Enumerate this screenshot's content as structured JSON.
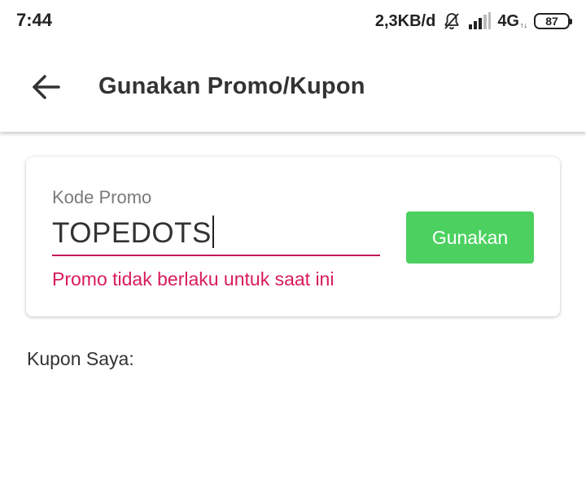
{
  "status_bar": {
    "time": "7:44",
    "network_speed": "2,3KB/d",
    "network_type": "4G",
    "network_sub": "↑↓",
    "battery": "87",
    "icons": [
      "bell-muted-icon",
      "signal-icon"
    ]
  },
  "toolbar": {
    "back_icon": "arrow-left-icon",
    "title": "Gunakan Promo/Kupon"
  },
  "promo": {
    "label": "Kode Promo",
    "value": "TOPEDOTS",
    "error": "Promo tidak berlaku untuk saat ini",
    "apply_label": "Gunakan"
  },
  "coupons": {
    "heading": "Kupon Saya:"
  },
  "colors": {
    "accent_green": "#4cd160",
    "error_pink": "#d81b5a",
    "underline": "#c2185b",
    "text_dark": "#333333",
    "label_gray": "#7a7a7a"
  }
}
